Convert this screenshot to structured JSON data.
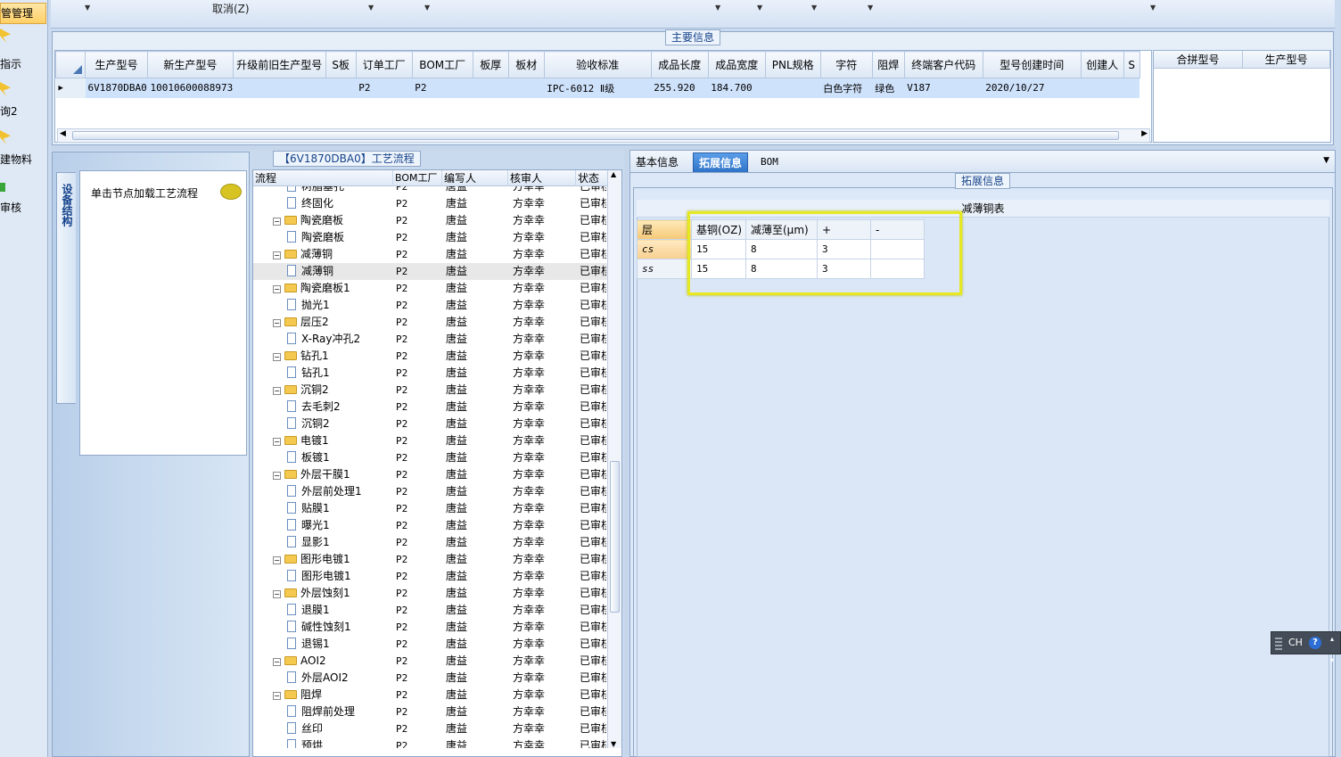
{
  "left_nav": {
    "header": "管管理",
    "items": [
      "指示",
      "询2",
      "建物料",
      "审核"
    ]
  },
  "toolbar": {
    "cancel_label": "取消(Z)"
  },
  "main_info": {
    "legend": "主要信息",
    "columns": [
      "生产型号",
      "新生产型号",
      "升级前旧生产型号",
      "S板",
      "订单工厂",
      "BOM工厂",
      "板厚",
      "板材",
      "验收标准",
      "成品长度",
      "成品宽度",
      "PNL规格",
      "字符",
      "阻焊",
      "终端客户代码",
      "型号创建时间",
      "创建人",
      "S"
    ],
    "rows": [
      [
        "6V1870DBA0",
        "10010600088973",
        "",
        "",
        "P2",
        "P2",
        "",
        "",
        "IPC-6012 Ⅱ级",
        "255.920",
        "184.700",
        "",
        "白色字符",
        "绿色",
        "V187",
        "2020/10/27",
        "",
        ""
      ]
    ],
    "merge_columns": [
      "合拼型号",
      "生产型号"
    ]
  },
  "process": {
    "legend": "【6V1870DBA0】工艺流程",
    "side_tab": "设备结构",
    "hint": "单击节点加载工艺流程",
    "columns": [
      "流程",
      "BOM工厂",
      "编写人",
      "核审人",
      "状态"
    ],
    "rows": [
      {
        "name": "树脂塞孔",
        "level": 2,
        "factory": "P2",
        "writer": "唐益",
        "reviewer": "方幸幸",
        "status": "已审核"
      },
      {
        "name": "终固化",
        "level": 2,
        "factory": "P2",
        "writer": "唐益",
        "reviewer": "方幸幸",
        "status": "已审核"
      },
      {
        "name": "陶瓷磨板",
        "level": 1,
        "factory": "P2",
        "writer": "唐益",
        "reviewer": "方幸幸",
        "status": "已审核"
      },
      {
        "name": "陶瓷磨板",
        "level": 2,
        "factory": "P2",
        "writer": "唐益",
        "reviewer": "方幸幸",
        "status": "已审核"
      },
      {
        "name": "减薄铜",
        "level": 1,
        "factory": "P2",
        "writer": "唐益",
        "reviewer": "方幸幸",
        "status": "已审核"
      },
      {
        "name": "减薄铜",
        "level": 2,
        "factory": "P2",
        "writer": "唐益",
        "reviewer": "方幸幸",
        "status": "已审核",
        "selected": true
      },
      {
        "name": "陶瓷磨板1",
        "level": 1,
        "factory": "P2",
        "writer": "唐益",
        "reviewer": "方幸幸",
        "status": "已审核"
      },
      {
        "name": "抛光1",
        "level": 2,
        "factory": "P2",
        "writer": "唐益",
        "reviewer": "方幸幸",
        "status": "已审核"
      },
      {
        "name": "层压2",
        "level": 1,
        "factory": "P2",
        "writer": "唐益",
        "reviewer": "方幸幸",
        "status": "已审核"
      },
      {
        "name": "X-Ray冲孔2",
        "level": 2,
        "factory": "P2",
        "writer": "唐益",
        "reviewer": "方幸幸",
        "status": "已审核"
      },
      {
        "name": "钻孔1",
        "level": 1,
        "factory": "P2",
        "writer": "唐益",
        "reviewer": "方幸幸",
        "status": "已审核"
      },
      {
        "name": "钻孔1",
        "level": 2,
        "factory": "P2",
        "writer": "唐益",
        "reviewer": "方幸幸",
        "status": "已审核"
      },
      {
        "name": "沉铜2",
        "level": 1,
        "factory": "P2",
        "writer": "唐益",
        "reviewer": "方幸幸",
        "status": "已审核"
      },
      {
        "name": "去毛刺2",
        "level": 2,
        "factory": "P2",
        "writer": "唐益",
        "reviewer": "方幸幸",
        "status": "已审核"
      },
      {
        "name": "沉铜2",
        "level": 2,
        "factory": "P2",
        "writer": "唐益",
        "reviewer": "方幸幸",
        "status": "已审核"
      },
      {
        "name": "电镀1",
        "level": 1,
        "factory": "P2",
        "writer": "唐益",
        "reviewer": "方幸幸",
        "status": "已审核"
      },
      {
        "name": "板镀1",
        "level": 2,
        "factory": "P2",
        "writer": "唐益",
        "reviewer": "方幸幸",
        "status": "已审核"
      },
      {
        "name": "外层干膜1",
        "level": 1,
        "factory": "P2",
        "writer": "唐益",
        "reviewer": "方幸幸",
        "status": "已审核"
      },
      {
        "name": "外层前处理1",
        "level": 2,
        "factory": "P2",
        "writer": "唐益",
        "reviewer": "方幸幸",
        "status": "已审核"
      },
      {
        "name": "贴膜1",
        "level": 2,
        "factory": "P2",
        "writer": "唐益",
        "reviewer": "方幸幸",
        "status": "已审核"
      },
      {
        "name": "曝光1",
        "level": 2,
        "factory": "P2",
        "writer": "唐益",
        "reviewer": "方幸幸",
        "status": "已审核"
      },
      {
        "name": "显影1",
        "level": 2,
        "factory": "P2",
        "writer": "唐益",
        "reviewer": "方幸幸",
        "status": "已审核"
      },
      {
        "name": "图形电镀1",
        "level": 1,
        "factory": "P2",
        "writer": "唐益",
        "reviewer": "方幸幸",
        "status": "已审核"
      },
      {
        "name": "图形电镀1",
        "level": 2,
        "factory": "P2",
        "writer": "唐益",
        "reviewer": "方幸幸",
        "status": "已审核"
      },
      {
        "name": "外层蚀刻1",
        "level": 1,
        "factory": "P2",
        "writer": "唐益",
        "reviewer": "方幸幸",
        "status": "已审核"
      },
      {
        "name": "退膜1",
        "level": 2,
        "factory": "P2",
        "writer": "唐益",
        "reviewer": "方幸幸",
        "status": "已审核"
      },
      {
        "name": "碱性蚀刻1",
        "level": 2,
        "factory": "P2",
        "writer": "唐益",
        "reviewer": "方幸幸",
        "status": "已审核"
      },
      {
        "name": "退锡1",
        "level": 2,
        "factory": "P2",
        "writer": "唐益",
        "reviewer": "方幸幸",
        "status": "已审核"
      },
      {
        "name": "AOI2",
        "level": 1,
        "factory": "P2",
        "writer": "唐益",
        "reviewer": "方幸幸",
        "status": "已审核"
      },
      {
        "name": "外层AOI2",
        "level": 2,
        "factory": "P2",
        "writer": "唐益",
        "reviewer": "方幸幸",
        "status": "已审核"
      },
      {
        "name": "阻焊",
        "level": 1,
        "factory": "P2",
        "writer": "唐益",
        "reviewer": "方幸幸",
        "status": "已审核"
      },
      {
        "name": "阻焊前处理",
        "level": 2,
        "factory": "P2",
        "writer": "唐益",
        "reviewer": "方幸幸",
        "status": "已审核"
      },
      {
        "name": "丝印",
        "level": 2,
        "factory": "P2",
        "writer": "唐益",
        "reviewer": "方幸幸",
        "status": "已审核"
      },
      {
        "name": "预烘",
        "level": 2,
        "factory": "P2",
        "writer": "唐益",
        "reviewer": "方幸幸",
        "status": "已审核"
      }
    ]
  },
  "detail": {
    "tabs": [
      "基本信息",
      "拓展信息",
      "BOM"
    ],
    "active_tab": 1,
    "legend": "拓展信息",
    "table_title": "减薄铜表",
    "columns": [
      "层",
      "基铜(OZ)",
      "减薄至(μm)",
      "+",
      "-"
    ],
    "rows": [
      [
        "cs",
        "15",
        "8",
        "3",
        ""
      ],
      [
        "ss",
        "15",
        "8",
        "3",
        ""
      ]
    ]
  },
  "ime": {
    "label": "CH",
    "help": "?"
  },
  "colors": {
    "accent": "#2f73c9",
    "highlight": "#e6e823",
    "selection": "#cfe2fb"
  }
}
